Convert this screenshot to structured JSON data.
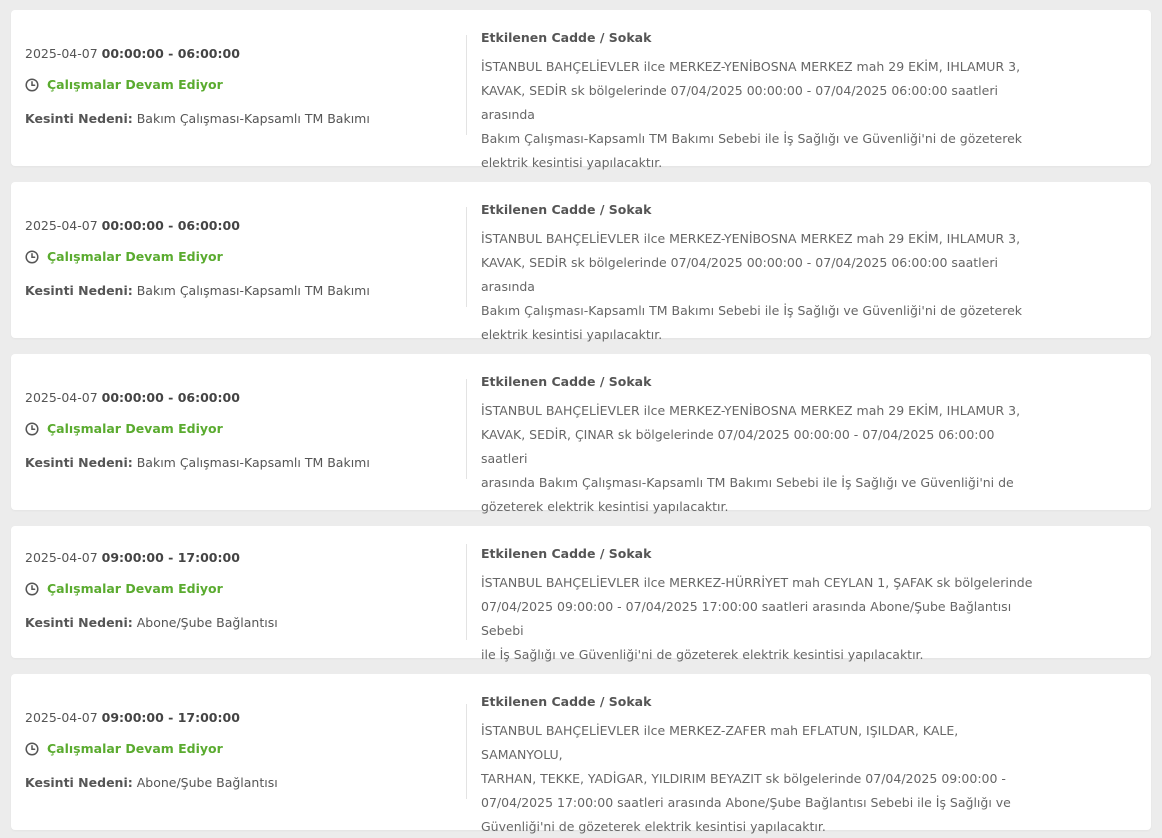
{
  "outages": [
    {
      "date": "2025-04-07",
      "time_range": "00:00:00 - 06:00:00",
      "status": "Çalışmalar Devam Ediyor",
      "reason_label": "Kesinti Nedeni:",
      "reason": "Bakım Çalışması-Kapsamlı TM Bakımı",
      "streets_title": "Etkilenen Cadde / Sokak",
      "description_lines": [
        "İSTANBUL BAHÇELİEVLER ilce MERKEZ-YENİBOSNA MERKEZ mah 29 EKİM, IHLAMUR 3,",
        "KAVAK, SEDİR sk bölgelerinde 07/04/2025 00:00:00 - 07/04/2025 06:00:00 saatleri arasında",
        "Bakım Çalışması-Kapsamlı TM Bakımı Sebebi ile İş Sağlığı ve Güvenliği'ni de gözeterek",
        "elektrik kesintisi yapılacaktır."
      ]
    },
    {
      "date": "2025-04-07",
      "time_range": "00:00:00 - 06:00:00",
      "status": "Çalışmalar Devam Ediyor",
      "reason_label": "Kesinti Nedeni:",
      "reason": "Bakım Çalışması-Kapsamlı TM Bakımı",
      "streets_title": "Etkilenen Cadde / Sokak",
      "description_lines": [
        "İSTANBUL BAHÇELİEVLER ilce MERKEZ-YENİBOSNA MERKEZ mah 29 EKİM, IHLAMUR 3,",
        "KAVAK, SEDİR sk bölgelerinde 07/04/2025 00:00:00 - 07/04/2025 06:00:00 saatleri arasında",
        "Bakım Çalışması-Kapsamlı TM Bakımı Sebebi ile İş Sağlığı ve Güvenliği'ni de gözeterek",
        "elektrik kesintisi yapılacaktır."
      ]
    },
    {
      "date": "2025-04-07",
      "time_range": "00:00:00 - 06:00:00",
      "status": "Çalışmalar Devam Ediyor",
      "reason_label": "Kesinti Nedeni:",
      "reason": "Bakım Çalışması-Kapsamlı TM Bakımı",
      "streets_title": "Etkilenen Cadde / Sokak",
      "description_lines": [
        "İSTANBUL BAHÇELİEVLER ilce MERKEZ-YENİBOSNA MERKEZ mah 29 EKİM, IHLAMUR 3,",
        "KAVAK, SEDİR, ÇINAR sk bölgelerinde 07/04/2025 00:00:00 - 07/04/2025 06:00:00 saatleri",
        "arasında Bakım Çalışması-Kapsamlı TM Bakımı Sebebi ile İş Sağlığı ve Güvenliği'ni de",
        "gözeterek elektrik kesintisi yapılacaktır."
      ]
    },
    {
      "date": "2025-04-07",
      "time_range": "09:00:00 - 17:00:00",
      "status": "Çalışmalar Devam Ediyor",
      "reason_label": "Kesinti Nedeni:",
      "reason": "Abone/Şube Bağlantısı",
      "streets_title": "Etkilenen Cadde / Sokak",
      "description_lines": [
        "İSTANBUL BAHÇELİEVLER ilce MERKEZ-HÜRRİYET mah CEYLAN 1, ŞAFAK sk bölgelerinde",
        "07/04/2025 09:00:00 - 07/04/2025 17:00:00 saatleri arasında Abone/Şube Bağlantısı Sebebi",
        "ile İş Sağlığı ve Güvenliği'ni de gözeterek elektrik kesintisi yapılacaktır."
      ]
    },
    {
      "date": "2025-04-07",
      "time_range": "09:00:00 - 17:00:00",
      "status": "Çalışmalar Devam Ediyor",
      "reason_label": "Kesinti Nedeni:",
      "reason": "Abone/Şube Bağlantısı",
      "streets_title": "Etkilenen Cadde / Sokak",
      "description_lines": [
        "İSTANBUL BAHÇELİEVLER ilce MERKEZ-ZAFER mah EFLATUN, IŞILDAR, KALE, SAMANYOLU,",
        "TARHAN, TEKKE, YADİGAR, YILDIRIM BEYAZIT sk bölgelerinde 07/04/2025 09:00:00 -",
        "07/04/2025 17:00:00 saatleri arasında Abone/Şube Bağlantısı Sebebi ile İş Sağlığı ve",
        "Güvenliği'ni de gözeterek elektrik kesintisi yapılacaktır."
      ]
    }
  ],
  "colors": {
    "status_green": "#5aab2f",
    "card_bg": "#ffffff",
    "page_bg": "#ececec"
  },
  "icons": {
    "status": "clock-icon"
  }
}
